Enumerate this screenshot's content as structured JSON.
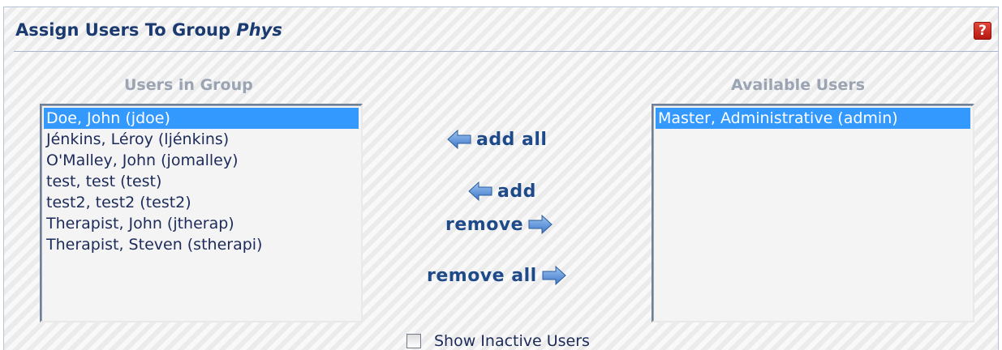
{
  "header": {
    "title_prefix": "Assign Users To Group ",
    "group_name": "Phys",
    "help_icon": "help-question-icon",
    "help_label": "?"
  },
  "users_in_group": {
    "heading": "Users in Group",
    "items": [
      {
        "label": "Doe, John (jdoe)",
        "selected": true
      },
      {
        "label": "Jénkins, Léroy (ljénkins)",
        "selected": false
      },
      {
        "label": "O'Malley, John (jomalley)",
        "selected": false
      },
      {
        "label": "test, test (test)",
        "selected": false
      },
      {
        "label": "test2, test2 (test2)",
        "selected": false
      },
      {
        "label": "Therapist, John (jtherap)",
        "selected": false
      },
      {
        "label": "Therapist, Steven (stherapi)",
        "selected": false
      }
    ]
  },
  "available_users": {
    "heading": "Available Users",
    "items": [
      {
        "label": "Master, Administrative (admin)",
        "selected": true
      }
    ]
  },
  "actions": {
    "add_all": "add all",
    "add": "add",
    "remove": "remove",
    "remove_all": "remove all",
    "left_arrow_icon": "arrow-left-icon",
    "right_arrow_icon": "arrow-right-icon"
  },
  "footer": {
    "show_inactive_label": "Show Inactive Users",
    "show_inactive_checked": false
  },
  "colors": {
    "title": "#1b3a70",
    "action_text": "#1f4a8a",
    "selection": "#3399ff",
    "heading": "#9aa4b3"
  }
}
